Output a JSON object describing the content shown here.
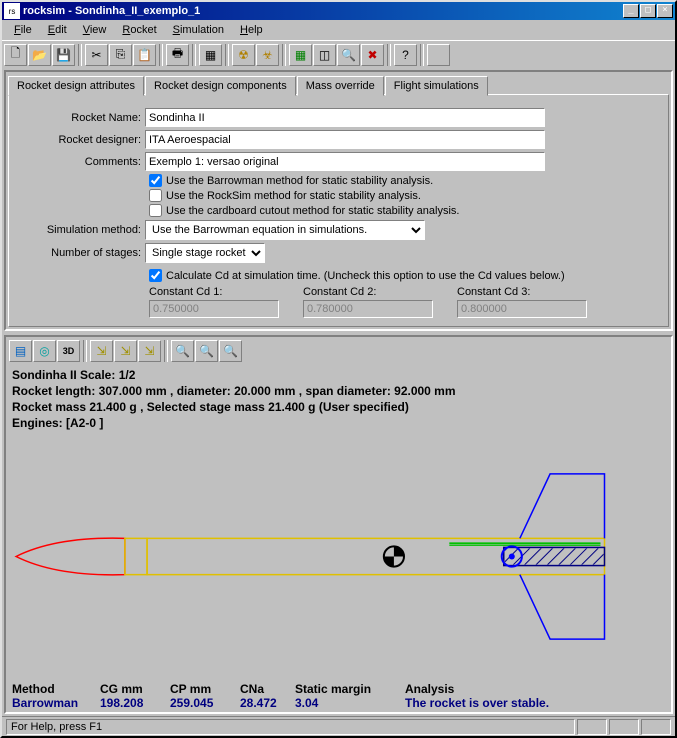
{
  "window": {
    "title": "rocksim - Sondinha_II_exemplo_1"
  },
  "menu": [
    "File",
    "Edit",
    "View",
    "Rocket",
    "Simulation",
    "Help"
  ],
  "menu_accel": [
    "F",
    "E",
    "V",
    "R",
    "S",
    "H"
  ],
  "tabs": [
    "Rocket design attributes",
    "Rocket design components",
    "Mass override",
    "Flight simulations"
  ],
  "form": {
    "rocket_name_label": "Rocket Name:",
    "rocket_name": "Sondinha II",
    "designer_label": "Rocket designer:",
    "designer": "ITA Aeroespacial",
    "comments_label": "Comments:",
    "comments": "Exemplo 1: versao original",
    "barrowman_label": "Use the Barrowman method for static stability analysis.",
    "rocksim_label": "Use the RockSim method for static stability analysis.",
    "cardboard_label": "Use the cardboard cutout method for static stability analysis.",
    "sim_method_label": "Simulation method:",
    "sim_method": "Use the Barrowman equation in simulations.",
    "stages_label": "Number of stages:",
    "stages": "Single stage rocket",
    "calc_cd_label": "Calculate Cd at simulation time. (Uncheck this option to use the Cd values below.)",
    "cd1_label": "Constant Cd 1:",
    "cd1": "0.750000",
    "cd2_label": "Constant Cd 2:",
    "cd2": "0.780000",
    "cd3_label": "Constant Cd 3:",
    "cd3": "0.800000"
  },
  "info": {
    "line1": "Sondinha II    Scale: 1/2",
    "line2": "Rocket length: 307.000  mm , diameter: 20.000  mm , span diameter: 92.000  mm",
    "line3": "Rocket mass 21.400 g , Selected stage mass 21.400 g (User specified)",
    "line4": "Engines: [A2-0  ]"
  },
  "results": {
    "headers": [
      "Method",
      "CG mm",
      "CP mm",
      "CNa",
      "Static margin",
      "Analysis"
    ],
    "values": [
      "Barrowman",
      "198.208",
      "259.045",
      "28.472",
      "3.04",
      "The rocket is over stable."
    ],
    "widths": [
      88,
      70,
      70,
      55,
      110,
      220
    ]
  },
  "status": "For Help, press F1"
}
